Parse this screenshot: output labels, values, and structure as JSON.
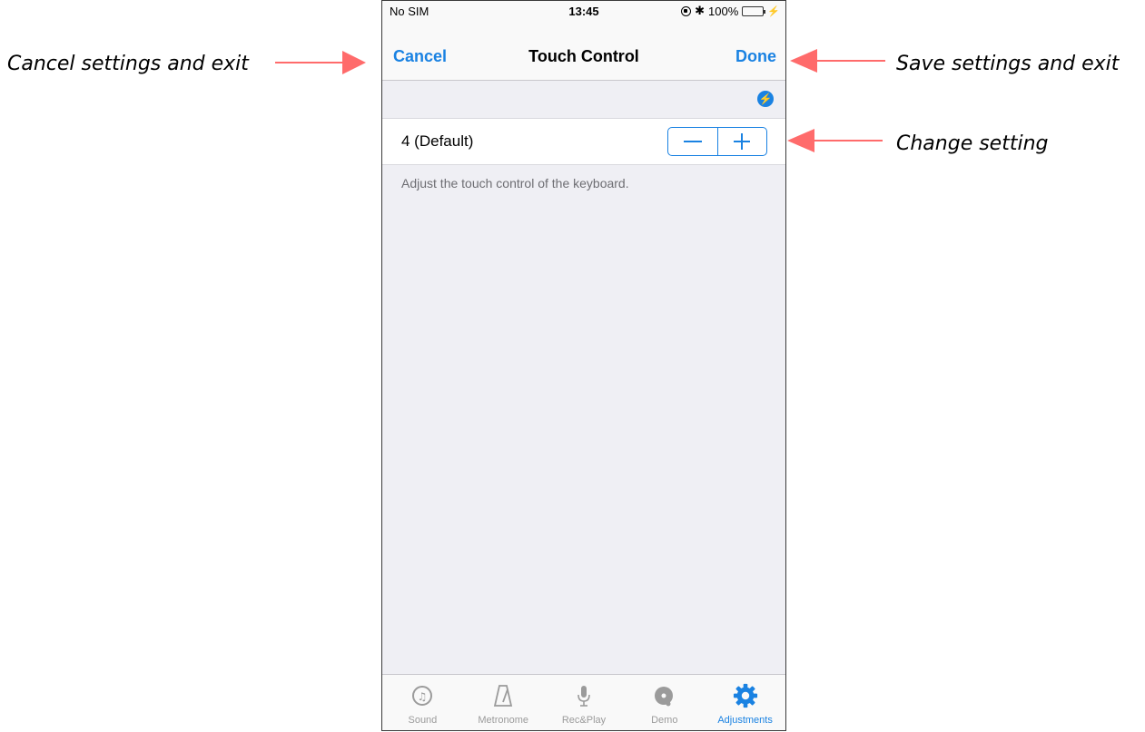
{
  "statusbar": {
    "carrier": "No SIM",
    "time": "13:45",
    "battery": "100%"
  },
  "nav": {
    "cancel": "Cancel",
    "title": "Touch Control",
    "done": "Done"
  },
  "setting": {
    "value": "4 (Default)",
    "hint": "Adjust the touch control of the keyboard."
  },
  "tabs": [
    {
      "label": "Sound",
      "icon": "sound-icon"
    },
    {
      "label": "Metronome",
      "icon": "metronome-icon"
    },
    {
      "label": "Rec&Play",
      "icon": "microphone-icon"
    },
    {
      "label": "Demo",
      "icon": "demo-disc-icon"
    },
    {
      "label": "Adjustments",
      "icon": "gear-icon",
      "active": true
    }
  ],
  "annotations": {
    "cancel": "Cancel settings and exit",
    "done": "Save settings and exit",
    "change": "Change setting"
  },
  "colors": {
    "accent": "#1a82e2",
    "arrow": "#ff6b6b",
    "battery": "#4cd964"
  }
}
